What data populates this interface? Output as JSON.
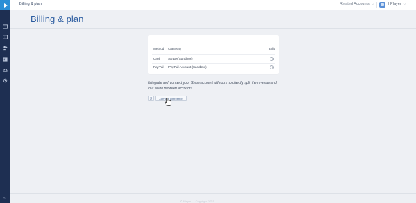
{
  "topbar": {
    "active_tab": "Billing & plan",
    "related_accounts": "Related Accounts",
    "player_name": "hPlayer"
  },
  "sidebar": {
    "items": [
      {
        "icon": "video-library-icon"
      },
      {
        "icon": "playlist-icon"
      },
      {
        "icon": "users-icon"
      },
      {
        "icon": "analytics-icon"
      },
      {
        "icon": "cloud-icon"
      },
      {
        "icon": "settings-icon"
      }
    ],
    "collapse_glyph": "«"
  },
  "page": {
    "title": "Billing & plan"
  },
  "payment_table": {
    "headers": {
      "method": "Method",
      "gateway": "Gateway",
      "edit": "Edit"
    },
    "rows": [
      {
        "method": "Card",
        "gateway": "Stripe (Sandbox)"
      },
      {
        "method": "PayPal",
        "gateway": "PayPal Account (Sandbox)"
      }
    ]
  },
  "stripe": {
    "info": "Integrate and connect your Stripe account with ours to directly split the revenue and our share between accounts.",
    "connect_label": "Connect with Stripe"
  },
  "footer": {
    "text": "© Player — Copyright 2021"
  },
  "colors": {
    "sidebar": "#1e2f52",
    "accent": "#2b8fd6",
    "title": "#2b5ca0"
  }
}
